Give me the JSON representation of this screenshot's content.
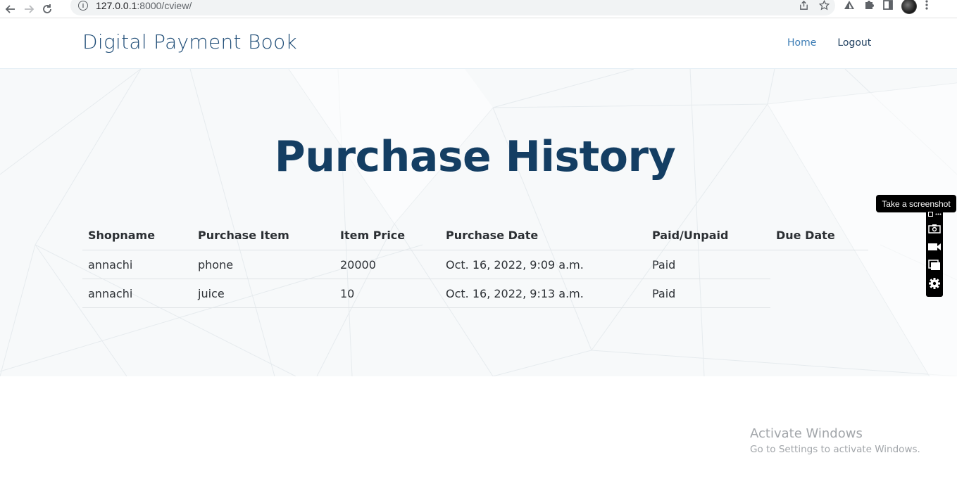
{
  "browser": {
    "url_host": "127.0.0.1",
    "url_path": ":8000/cview/"
  },
  "site": {
    "logo": "Digital Payment Book",
    "nav": {
      "home": "Home",
      "logout": "Logout"
    }
  },
  "page": {
    "title": "Purchase History"
  },
  "table": {
    "headers": [
      "Shopname",
      "Purchase Item",
      "Item Price",
      "Purchase Date",
      "Paid/Unpaid",
      "Due Date"
    ],
    "rows": [
      [
        "annachi",
        "phone",
        "20000",
        "Oct. 16, 2022, 9:09 a.m.",
        "Paid"
      ],
      [
        "annachi",
        "juice",
        "10",
        "Oct. 16, 2022, 9:13 a.m.",
        "Paid"
      ]
    ]
  },
  "screenshot_tool": {
    "tooltip": "Take a screenshot"
  },
  "watermark": {
    "line1": "Activate Windows",
    "line2": "Go to Settings to activate Windows."
  },
  "colors": {
    "brand": "#1f4d77",
    "title": "#143e63",
    "nav_active": "#3a7bb4"
  }
}
